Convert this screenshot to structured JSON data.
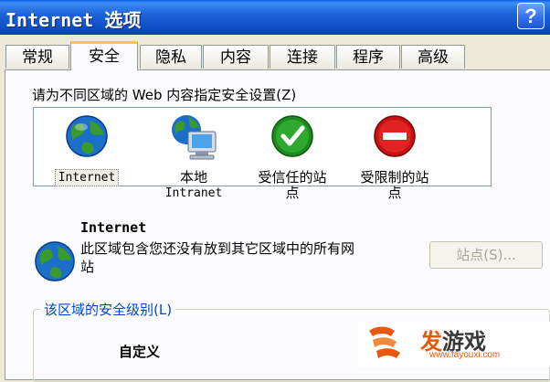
{
  "window": {
    "title": "Internet 选项",
    "help_label": "?"
  },
  "tabs": [
    {
      "label": "常规"
    },
    {
      "label": "安全"
    },
    {
      "label": "隐私"
    },
    {
      "label": "内容"
    },
    {
      "label": "连接"
    },
    {
      "label": "程序"
    },
    {
      "label": "高级"
    }
  ],
  "active_tab": "安全",
  "security": {
    "prompt": "请为不同区域的 Web 内容指定安全设置(Z)",
    "zones": [
      {
        "label": "Internet",
        "icon": "globe-icon",
        "selected": true
      },
      {
        "label_line1": "本地",
        "label_line2": "Intranet",
        "icon": "computer-globe-icon"
      },
      {
        "label_line1": "受信任的站",
        "label_line2": "点",
        "icon": "green-check-icon"
      },
      {
        "label_line1": "受限制的站",
        "label_line2": "点",
        "icon": "red-no-entry-icon"
      }
    ],
    "selected_zone_title": "Internet",
    "selected_zone_desc": "此区域包含您还没有放到其它区域中的所有网站",
    "sites_button": "站点(S)...",
    "level_group_label": "该区域的安全级别(L)",
    "level_name": "自定义"
  },
  "watermark": {
    "brand_a": "发",
    "brand_b": "游戏",
    "url": "www.fayouxi.com"
  },
  "colors": {
    "titlebar": "#0b4cc4",
    "tab_highlight": "#ffc83c",
    "group_label": "#0046d5",
    "watermark_accent": "#e8580c"
  }
}
